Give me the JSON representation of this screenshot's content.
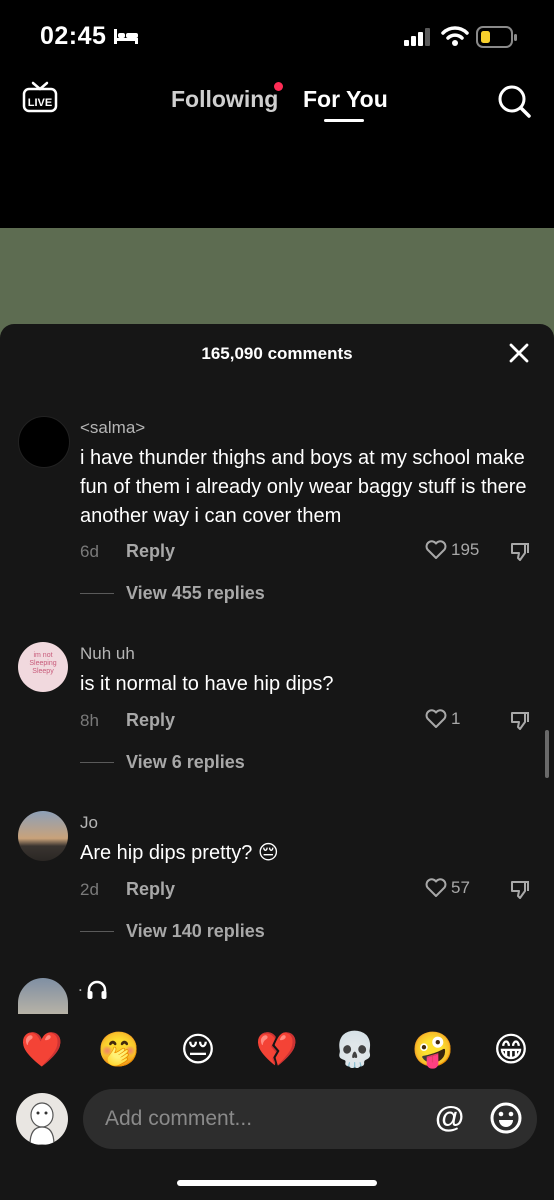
{
  "status_bar": {
    "time": "02:45"
  },
  "top_nav": {
    "live_label": "LIVE",
    "tabs": [
      {
        "label": "Following"
      },
      {
        "label": "For You"
      }
    ]
  },
  "comments_sheet": {
    "title": "165,090 comments",
    "comments": [
      {
        "username": "<salma>",
        "text": "i have thunder thighs and boys at my school make fun of them i already only wear baggy stuff is there another way i can cover them",
        "time": "6d",
        "reply_label": "Reply",
        "likes": "195",
        "view_replies": "View 455 replies"
      },
      {
        "username": "Nuh uh",
        "text": "is it normal to have hip dips?",
        "time": "8h",
        "reply_label": "Reply",
        "likes": "1",
        "view_replies": "View 6 replies",
        "avatar_text": "im not Sleeping Sleepy"
      },
      {
        "username": "Jo",
        "text": "Are hip dips pretty?",
        "emoji": "😔",
        "time": "2d",
        "reply_label": "Reply",
        "likes": "57",
        "view_replies": "View 140 replies"
      },
      {
        "username": "."
      }
    ]
  },
  "emoji_bar": [
    "❤️",
    "🤭",
    "😔",
    "💔",
    "💀",
    "🤪",
    "😁"
  ],
  "composer": {
    "placeholder": "Add comment...",
    "at_symbol": "@"
  }
}
